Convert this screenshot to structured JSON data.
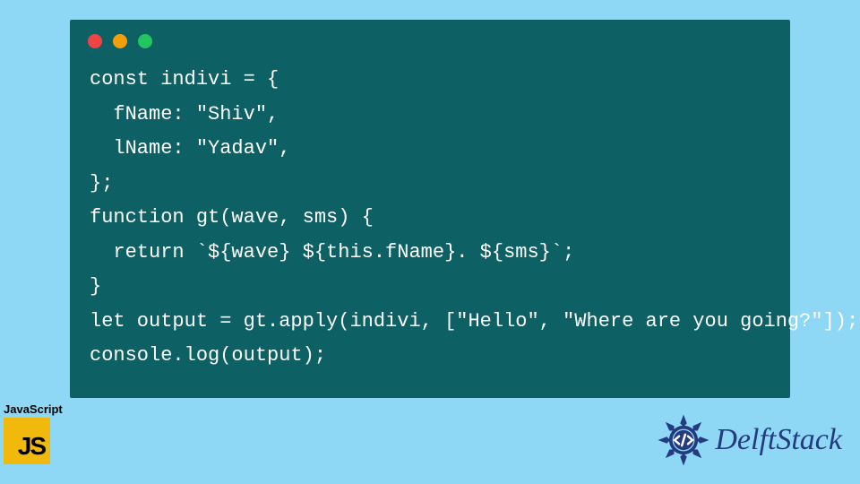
{
  "code": {
    "lines": [
      "const indivi = {",
      "  fName: \"Shiv\",",
      "  lName: \"Yadav\",",
      "};",
      "function gt(wave, sms) {",
      "  return `${wave} ${this.fName}. ${sms}`;",
      "}",
      "let output = gt.apply(indivi, [\"Hello\", \"Where are you going?\"]);",
      "console.log(output);"
    ]
  },
  "js_badge": {
    "label": "JavaScript",
    "logo_text": "JS"
  },
  "brand": {
    "name": "DelftStack",
    "icon": "gear-code-icon"
  },
  "colors": {
    "page_bg": "#8fd8f5",
    "window_bg": "#0d6165",
    "code_fg": "#ffffff",
    "js_logo_bg": "#f0b90b",
    "brand_fg": "#243b7f"
  }
}
